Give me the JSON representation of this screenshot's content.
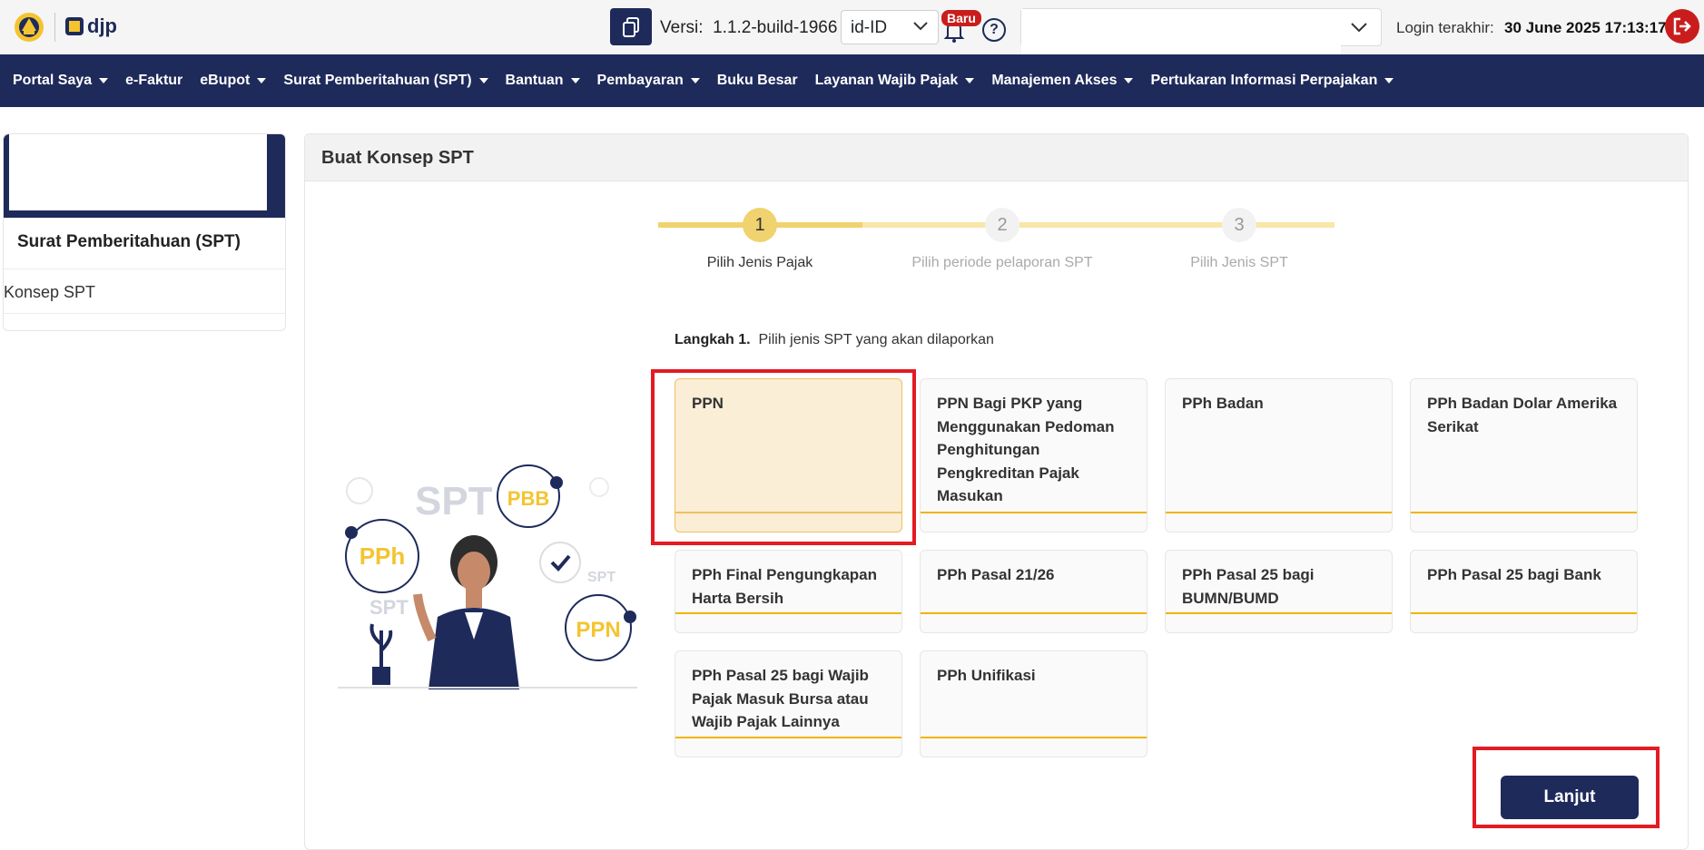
{
  "topbar": {
    "logo_text": "djp",
    "version_label": "Versi:",
    "version_value": "1.1.2-build-1966",
    "language": "id-ID",
    "new_badge": "Baru",
    "help_symbol": "?",
    "login_label": "Login terakhir:",
    "login_date": "30 June 2025 17:13:17"
  },
  "nav": {
    "items": [
      {
        "label": "Portal Saya",
        "dropdown": true
      },
      {
        "label": "e-Faktur",
        "dropdown": false
      },
      {
        "label": "eBupot",
        "dropdown": true
      },
      {
        "label": "Surat Pemberitahuan (SPT)",
        "dropdown": true
      },
      {
        "label": "Bantuan",
        "dropdown": true
      },
      {
        "label": "Pembayaran",
        "dropdown": true
      },
      {
        "label": "Buku Besar",
        "dropdown": false
      },
      {
        "label": "Layanan Wajib Pajak",
        "dropdown": true
      },
      {
        "label": "Manajemen Akses",
        "dropdown": true
      },
      {
        "label": "Pertukaran Informasi Perpajakan",
        "dropdown": true
      }
    ]
  },
  "sidebar": {
    "title": "Surat Pemberitahuan (SPT)",
    "link": "Konsep SPT"
  },
  "main": {
    "title": "Buat Konsep SPT",
    "steps": [
      {
        "number": "1",
        "label": "Pilih Jenis Pajak",
        "active": true
      },
      {
        "number": "2",
        "label": "Pilih periode pelaporan SPT",
        "active": false
      },
      {
        "number": "3",
        "label": "Pilih Jenis SPT",
        "active": false
      }
    ],
    "instruction_bold": "Langkah 1.",
    "instruction_text": "Pilih jenis SPT yang akan dilaporkan",
    "options": [
      "PPN",
      "PPN Bagi PKP yang Menggunakan Pedoman Penghitungan Pengkreditan Pajak Masukan",
      "PPh Badan",
      "PPh Badan Dolar Amerika Serikat",
      "PPh Final Pengungkapan Harta Bersih",
      "PPh Pasal 21/26",
      "PPh Pasal 25 bagi BUMN/BUMD",
      "PPh Pasal 25 bagi Bank",
      "PPh Pasal 25 bagi Wajib Pajak Masuk Bursa atau Wajib Pajak Lainnya",
      "PPh Unifikasi"
    ],
    "selected_option": "PPN",
    "next_button": "Lanjut",
    "illustration_labels": {
      "spt_big": "SPT",
      "pbb": "PBB",
      "pph": "PPh",
      "spt_small": "SPT",
      "spt_tiny": "SPT",
      "ppn": "PPN"
    }
  },
  "colors": {
    "navy": "#1e2a5a",
    "accent": "#f0b400",
    "danger": "#c91d1d",
    "highlight": "#e31b23"
  }
}
